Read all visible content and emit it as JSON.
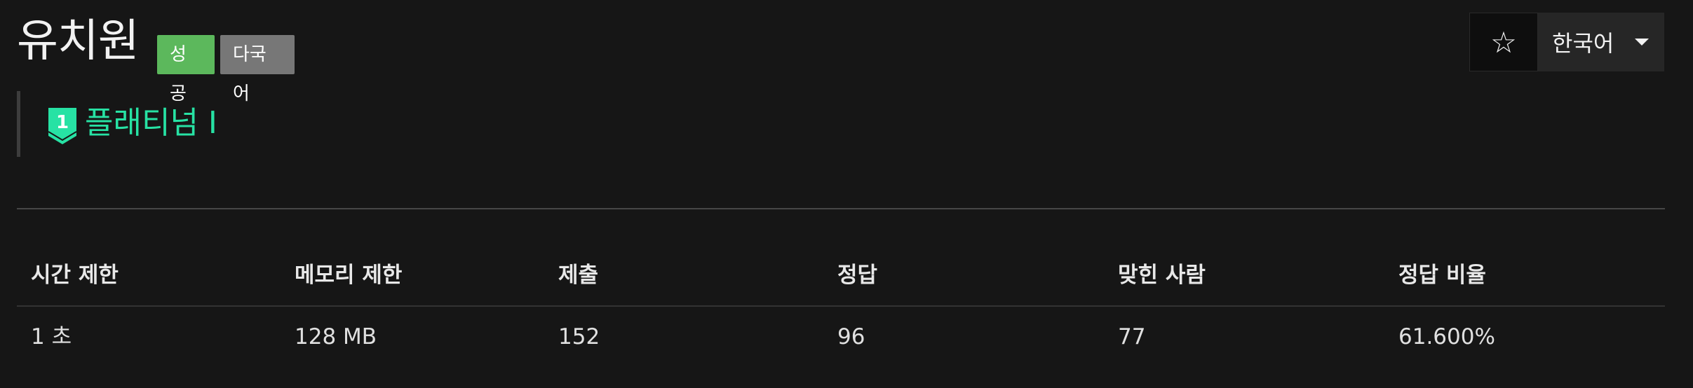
{
  "problem": {
    "title": "유치원",
    "badges": {
      "success": "성공",
      "multilang": "다국어"
    },
    "tier": {
      "icon_number": "1",
      "label": "플래티넘 I",
      "color": "#27e2a4"
    }
  },
  "toolbar": {
    "star_icon": "star-outline-icon",
    "star_glyph": "☆",
    "language": "한국어"
  },
  "info_table": {
    "headers": [
      "시간 제한",
      "메모리 제한",
      "제출",
      "정답",
      "맞힌 사람",
      "정답 비율"
    ],
    "values": [
      "1 초",
      "128 MB",
      "152",
      "96",
      "77",
      "61.600%"
    ]
  },
  "colors": {
    "background": "#161616",
    "badge_success": "#5cb85c",
    "badge_lang": "#777777"
  }
}
